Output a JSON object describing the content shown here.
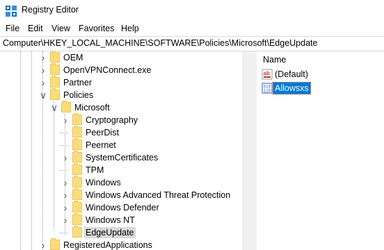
{
  "window": {
    "title": "Registry Editor"
  },
  "menu": [
    "File",
    "Edit",
    "View",
    "Favorites",
    "Help"
  ],
  "address": "Computer\\HKEY_LOCAL_MACHINE\\SOFTWARE\\Policies\\Microsoft\\EdgeUpdate",
  "tree": {
    "nodes": [
      {
        "label": "OEM",
        "expander": "collapsed",
        "level": 1
      },
      {
        "label": "OpenVPNConnect.exe",
        "expander": "collapsed",
        "level": 1
      },
      {
        "label": "Partner",
        "expander": "collapsed",
        "level": 1
      },
      {
        "label": "Policies",
        "expander": "expanded",
        "level": 1
      },
      {
        "label": "Microsoft",
        "expander": "expanded",
        "level": 2
      },
      {
        "label": "Cryptography",
        "expander": "collapsed",
        "level": 3
      },
      {
        "label": "PeerDist",
        "expander": "none",
        "level": 3
      },
      {
        "label": "Peernet",
        "expander": "none",
        "level": 3
      },
      {
        "label": "SystemCertificates",
        "expander": "collapsed",
        "level": 3
      },
      {
        "label": "TPM",
        "expander": "none",
        "level": 3
      },
      {
        "label": "Windows",
        "expander": "collapsed",
        "level": 3
      },
      {
        "label": "Windows Advanced Threat Protection",
        "expander": "collapsed",
        "level": 3
      },
      {
        "label": "Windows Defender",
        "expander": "collapsed",
        "level": 3
      },
      {
        "label": "Windows NT",
        "expander": "collapsed",
        "level": 3
      },
      {
        "label": "EdgeUpdate",
        "expander": "none",
        "level": 3,
        "selected": true
      },
      {
        "label": "RegisteredApplications",
        "expander": "collapsed",
        "level": 1
      }
    ]
  },
  "list": {
    "column_name": "Name",
    "values": [
      {
        "name": "(Default)",
        "icon": "string-value-icon",
        "selected": false
      },
      {
        "name": "Allowsxs",
        "icon": "binary-value-icon",
        "selected": true
      }
    ]
  },
  "colors": {
    "selection": "#0078d7",
    "folder": "#fcdc7a",
    "splitter": "#f0f0f0"
  }
}
